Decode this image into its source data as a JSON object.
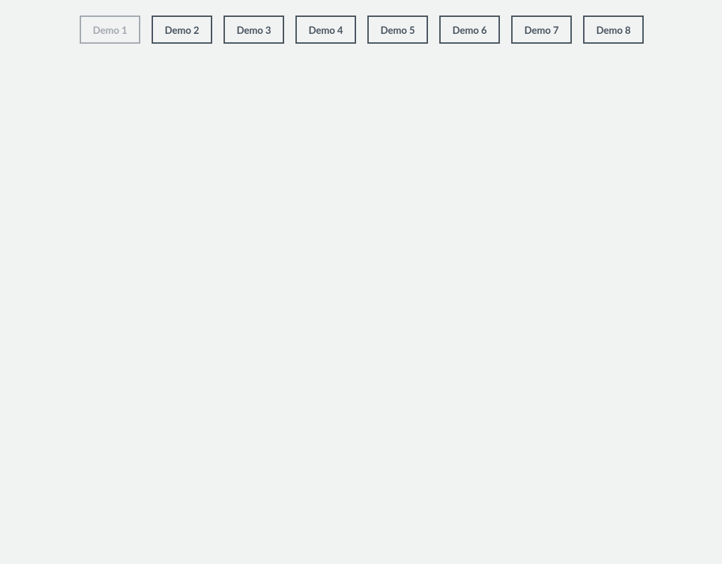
{
  "tabs": [
    {
      "label": "Demo 1",
      "active": true
    },
    {
      "label": "Demo 2",
      "active": false
    },
    {
      "label": "Demo 3",
      "active": false
    },
    {
      "label": "Demo 4",
      "active": false
    },
    {
      "label": "Demo 5",
      "active": false
    },
    {
      "label": "Demo 6",
      "active": false
    },
    {
      "label": "Demo 7",
      "active": false
    },
    {
      "label": "Demo 8",
      "active": false
    }
  ]
}
